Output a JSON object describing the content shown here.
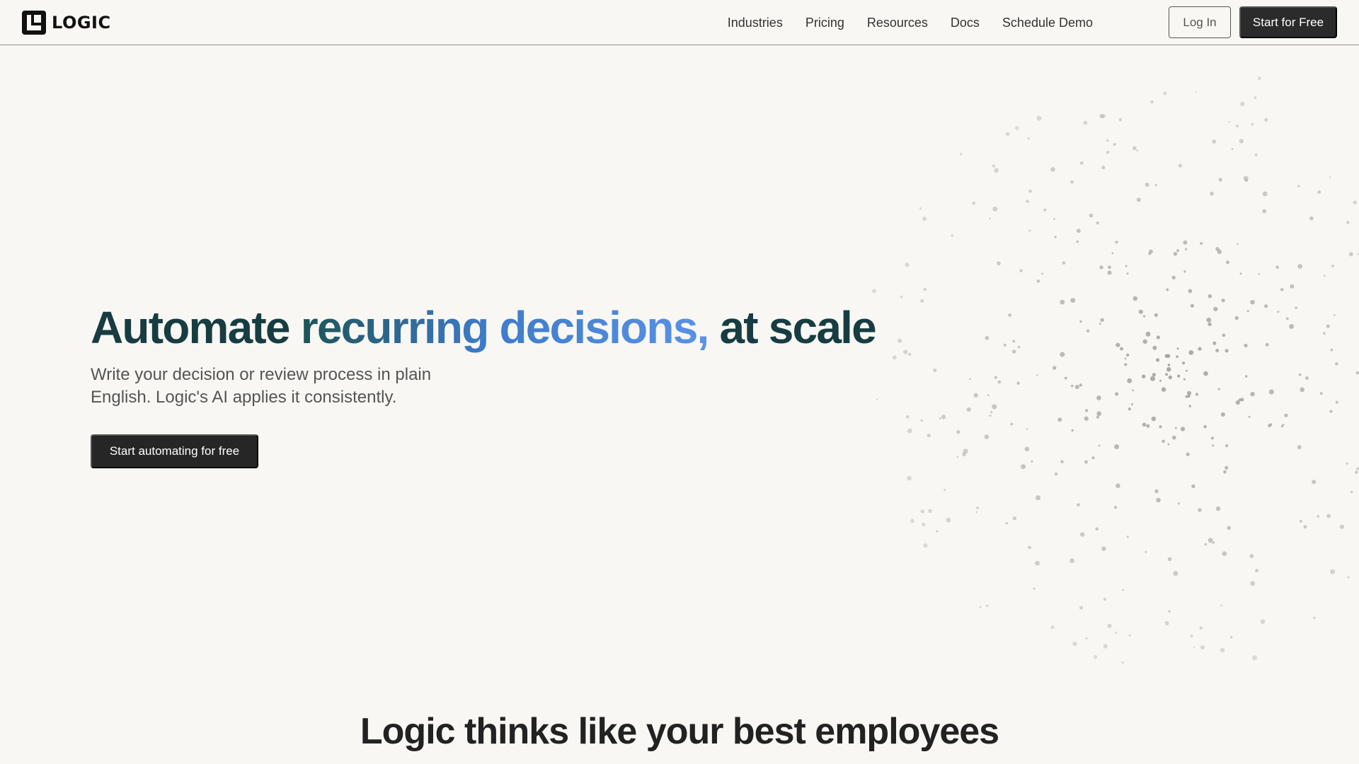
{
  "brand": {
    "name": "LOGIC",
    "logo_icon": "logic-logo-icon"
  },
  "nav": {
    "links": [
      "Industries",
      "Pricing",
      "Resources",
      "Docs",
      "Schedule Demo"
    ],
    "login_label": "Log In",
    "start_label": "Start for Free"
  },
  "hero": {
    "title_part1": "Automate ",
    "title_part2": "recurring decisions,",
    "title_part3": " at scale",
    "subtitle": "Write your decision or review process in plain English. Logic's AI applies it consistently.",
    "cta_label": "Start automating for free"
  },
  "section": {
    "title": "Logic thinks like your best employees"
  },
  "colors": {
    "background": "#f8f7f3",
    "title_dark": "#173d42",
    "title_gradient_end": "#5a92e6",
    "button_dark": "#2b2b2b",
    "particle": "#9a9a9a"
  }
}
